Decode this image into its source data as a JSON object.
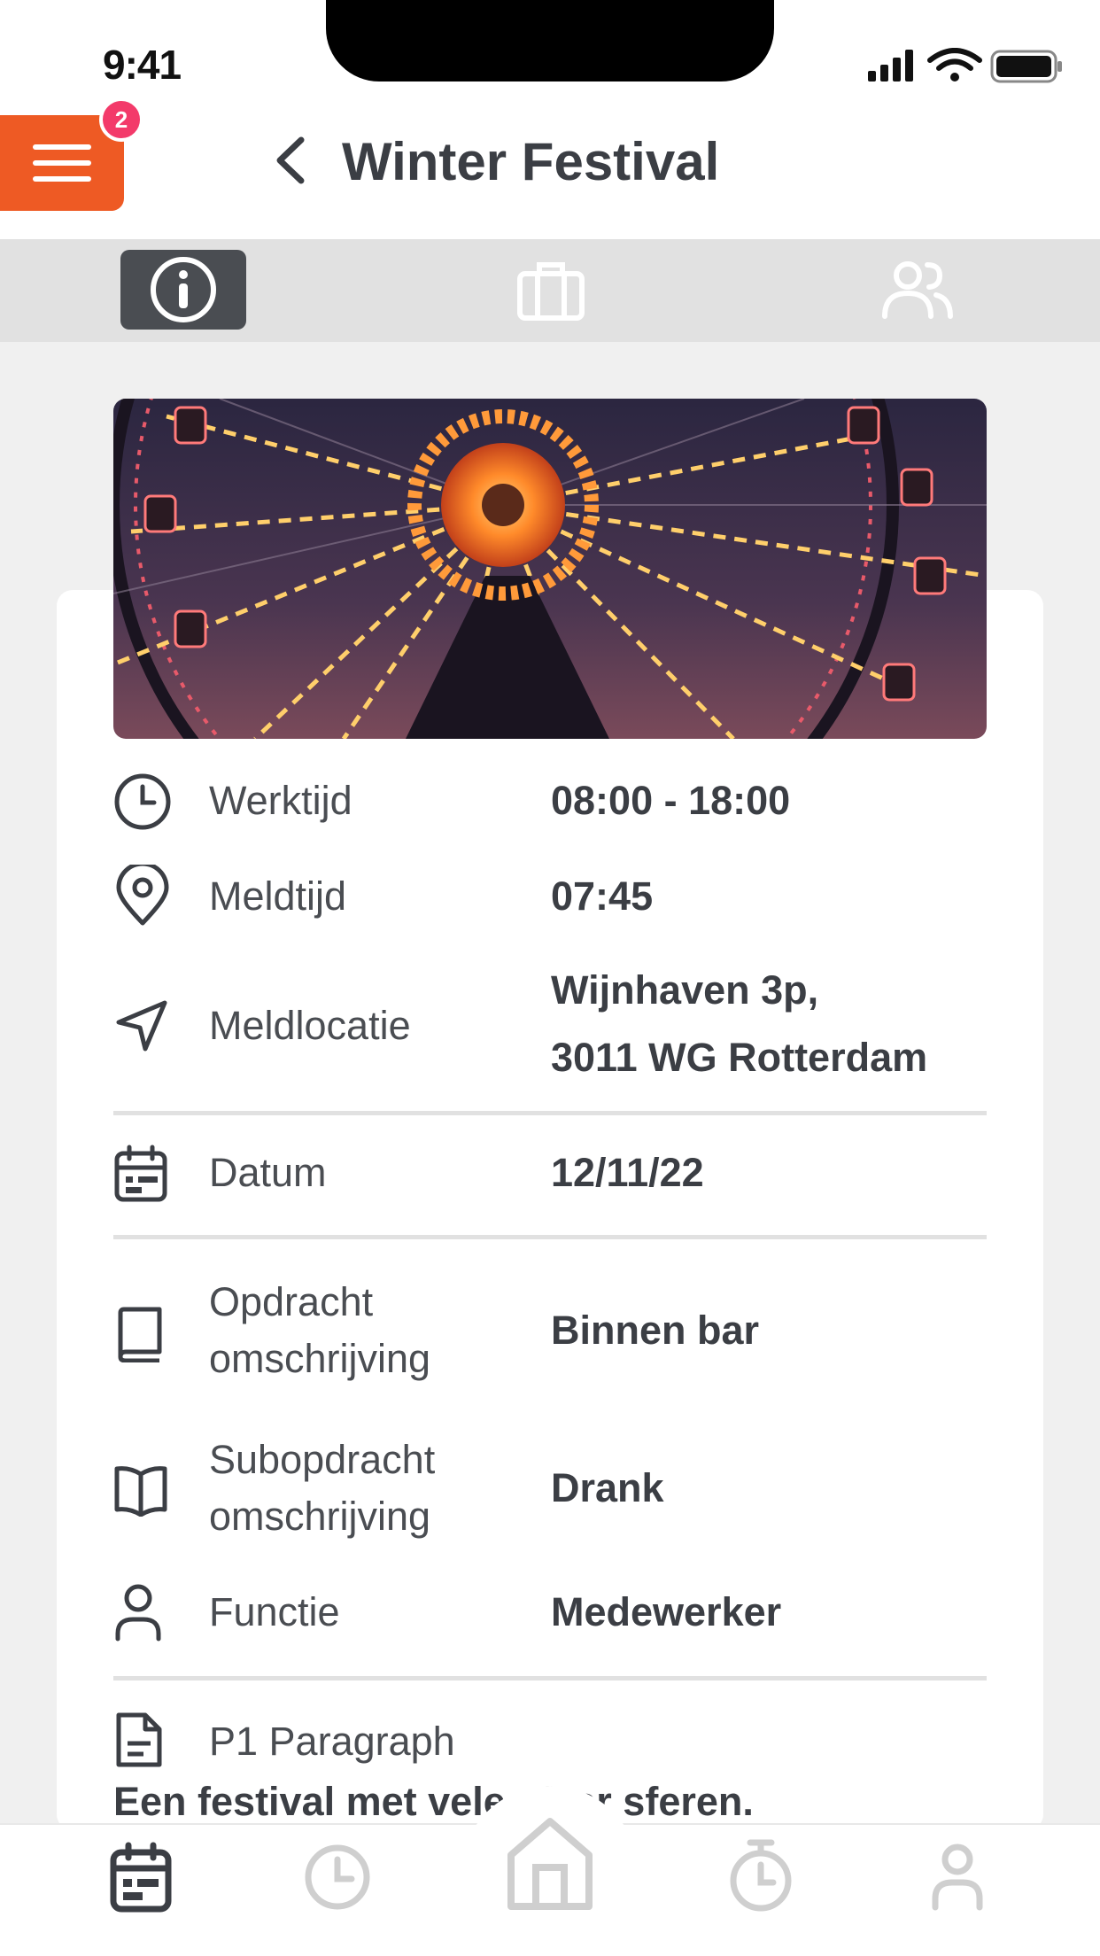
{
  "status_bar": {
    "time": "9:41"
  },
  "header": {
    "menu_badge": "2",
    "title": "Winter Festival",
    "accent_color": "#ee5a24",
    "badge_color": "#f33a6a"
  },
  "tabs": [
    {
      "icon": "info-icon",
      "active": true
    },
    {
      "icon": "briefcase-icon",
      "active": false
    },
    {
      "icon": "users-icon",
      "active": false
    }
  ],
  "details": {
    "werktijd": {
      "label": "Werktijd",
      "value": "08:00 - 18:00",
      "icon": "clock-icon"
    },
    "meldtijd": {
      "label": "Meldtijd",
      "value": "07:45",
      "icon": "map-pin-icon"
    },
    "meldlocatie": {
      "label": "Meldlocatie",
      "value_line1": "Wijnhaven 3p,",
      "value_line2": "3011 WG Rotterdam",
      "icon": "navigation-icon"
    },
    "datum": {
      "label": "Datum",
      "value": "12/11/22",
      "icon": "calendar-icon"
    },
    "opdracht": {
      "label_line1": "Opdracht",
      "label_line2": "omschrijving",
      "value": "Binnen bar",
      "icon": "book-icon"
    },
    "subopdracht": {
      "label_line1": "Subopdracht",
      "label_line2": "omschrijving",
      "value": "Drank",
      "icon": "open-book-icon"
    },
    "functie": {
      "label": "Functie",
      "value": "Medewerker",
      "icon": "user-icon"
    },
    "paragraph": {
      "label": "P1 Paragraph",
      "text": "Een festival met vele sfeer sferen.",
      "icon": "document-icon"
    }
  },
  "bottom_nav": [
    {
      "icon": "calendar-icon",
      "active": true
    },
    {
      "icon": "clock-icon",
      "active": false
    },
    {
      "icon": "home-icon",
      "active": false
    },
    {
      "icon": "stopwatch-icon",
      "active": false
    },
    {
      "icon": "profile-icon",
      "active": false
    }
  ]
}
